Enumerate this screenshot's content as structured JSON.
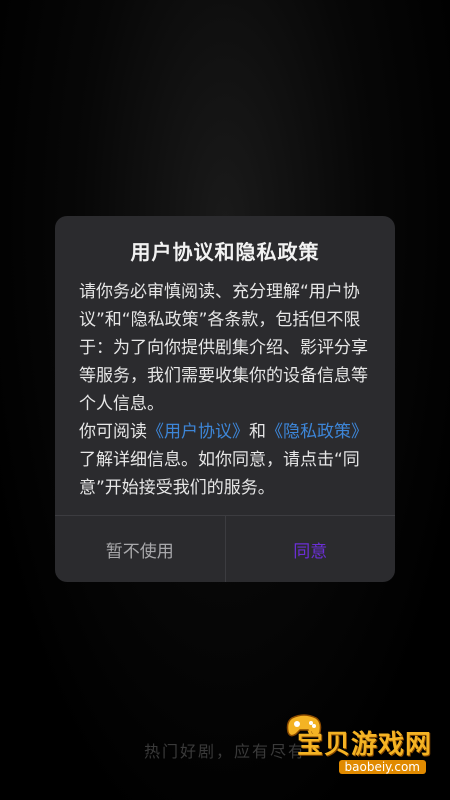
{
  "dialog": {
    "title": "用户协议和隐私政策",
    "body_intro": "请你务必审慎阅读、充分理解“用户协议”和“隐私政策”各条款，包括但不限于：为了向你提供剧集介绍、影评分享等服务，我们需要收集你的设备信息等个人信息。",
    "body_read_prefix": "你可阅读",
    "link_user_agreement": "《用户协议》",
    "body_and": "和",
    "link_privacy_policy": "《隐私政策》",
    "body_suffix": "了解详细信息。如你同意，请点击“同意”开始接受我们的服务。",
    "decline_label": "暂不使用",
    "accept_label": "同意"
  },
  "background": {
    "tagline": "热门好剧，应有尽有"
  },
  "watermark": {
    "brand": "宝贝游戏网",
    "domain": "baobeiy.com"
  },
  "colors": {
    "accent": "#6b2fd6",
    "link": "#3d86d8",
    "dialog_bg": "#2b2b2e"
  }
}
